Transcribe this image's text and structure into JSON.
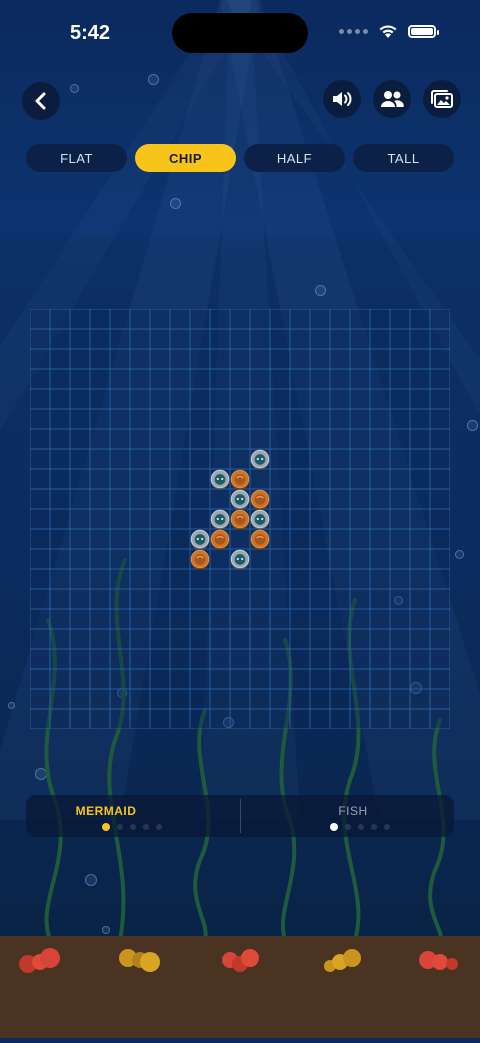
{
  "status_bar": {
    "time": "5:42"
  },
  "top_buttons": [
    {
      "name": "back",
      "icon": "chevron-left-icon"
    },
    {
      "name": "sound",
      "icon": "speaker-icon"
    },
    {
      "name": "players",
      "icon": "people-icon"
    },
    {
      "name": "gallery",
      "icon": "photos-icon"
    }
  ],
  "tabs": [
    {
      "label": "FLAT",
      "active": false
    },
    {
      "label": "CHIP",
      "active": true
    },
    {
      "label": "HALF",
      "active": false
    },
    {
      "label": "TALL",
      "active": false
    }
  ],
  "board": {
    "columns": 21,
    "rows": 21,
    "pieces": [
      {
        "col": 11,
        "row": 7,
        "type": "fish"
      },
      {
        "col": 9,
        "row": 8,
        "type": "fish"
      },
      {
        "col": 10,
        "row": 8,
        "type": "mermaid"
      },
      {
        "col": 10,
        "row": 9,
        "type": "fish"
      },
      {
        "col": 11,
        "row": 9,
        "type": "mermaid"
      },
      {
        "col": 9,
        "row": 10,
        "type": "fish"
      },
      {
        "col": 10,
        "row": 10,
        "type": "mermaid"
      },
      {
        "col": 11,
        "row": 10,
        "type": "fish"
      },
      {
        "col": 8,
        "row": 11,
        "type": "fish"
      },
      {
        "col": 9,
        "row": 11,
        "type": "mermaid"
      },
      {
        "col": 11,
        "row": 11,
        "type": "mermaid"
      },
      {
        "col": 8,
        "row": 12,
        "type": "mermaid"
      },
      {
        "col": 10,
        "row": 12,
        "type": "fish"
      }
    ]
  },
  "players": [
    {
      "name": "MERMAID",
      "active": true,
      "pips_total": 5,
      "pips_on": 1
    },
    {
      "name": "FISH",
      "active": false,
      "pips_total": 5,
      "pips_on": 1
    }
  ],
  "colors": {
    "accent": "#f7c51a",
    "grid": "#2f6bb0",
    "mermaid_piece": "#c8742c",
    "fish_piece": "#9aa7b0"
  }
}
